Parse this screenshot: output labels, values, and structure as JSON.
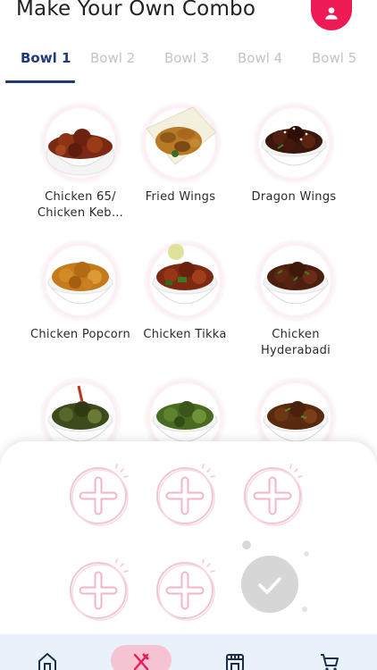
{
  "header": {
    "title": "Make Your Own Combo",
    "profile_icon": "user-icon",
    "accent_color": "#ee1a55"
  },
  "tabs": [
    {
      "label": "Bowl 1",
      "active": true
    },
    {
      "label": "Bowl 2",
      "active": false
    },
    {
      "label": "Bowl 3",
      "active": false
    },
    {
      "label": "Bowl 4",
      "active": false
    },
    {
      "label": "Bowl 5",
      "active": false
    }
  ],
  "items": [
    {
      "label": "Chicken 65/ Chicken Keb…"
    },
    {
      "label": "Fried Wings"
    },
    {
      "label": "Dragon Wings"
    },
    {
      "label": "Chicken Popcorn"
    },
    {
      "label": "Chicken Tikka"
    },
    {
      "label": "Chicken Hyderabadi"
    },
    {
      "label": ""
    },
    {
      "label": ""
    },
    {
      "label": ""
    }
  ],
  "combo_tray": {
    "slots": [
      {
        "icon": "add-icon"
      },
      {
        "icon": "add-icon"
      },
      {
        "icon": "add-icon"
      },
      {
        "icon": "add-icon"
      },
      {
        "icon": "add-icon"
      }
    ],
    "confirm_icon": "check-icon"
  },
  "bottom_nav": [
    {
      "icon": "home-icon",
      "active": false
    },
    {
      "icon": "fork-knife-icon",
      "active": true
    },
    {
      "icon": "store-icon",
      "active": false
    },
    {
      "icon": "cart-icon",
      "active": false
    }
  ]
}
